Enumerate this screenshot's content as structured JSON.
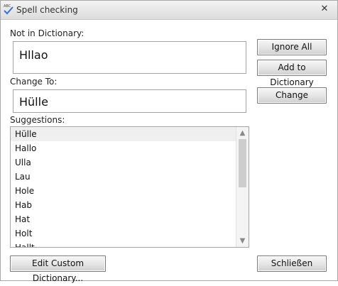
{
  "window": {
    "title": "Spell checking",
    "icon_text": "ABC",
    "close_glyph": "✕"
  },
  "form": {
    "not_in_dictionary_label": "Not in Dictionary:",
    "not_in_dictionary_value": "Hllao",
    "change_to_label": "Change To:",
    "change_to_value": "Hülle",
    "suggestions_label": "Suggestions:"
  },
  "suggestions": {
    "items": [
      "Hülle",
      "Hallo",
      "Ulla",
      "Lau",
      "Hole",
      "Hab",
      "Hat",
      "Holt",
      "Hallt"
    ],
    "selected_index": 0,
    "scroll_position": 0.0
  },
  "buttons": {
    "ignore_all": "Ignore All",
    "add_to_dictionary": "Add to Dictionary",
    "change": "Change",
    "edit_custom_dictionary": "Edit Custom Dictionary...",
    "close": "Schließen"
  },
  "colors": {
    "check_mark": "#3a6fd0",
    "selection": "#efefef"
  }
}
